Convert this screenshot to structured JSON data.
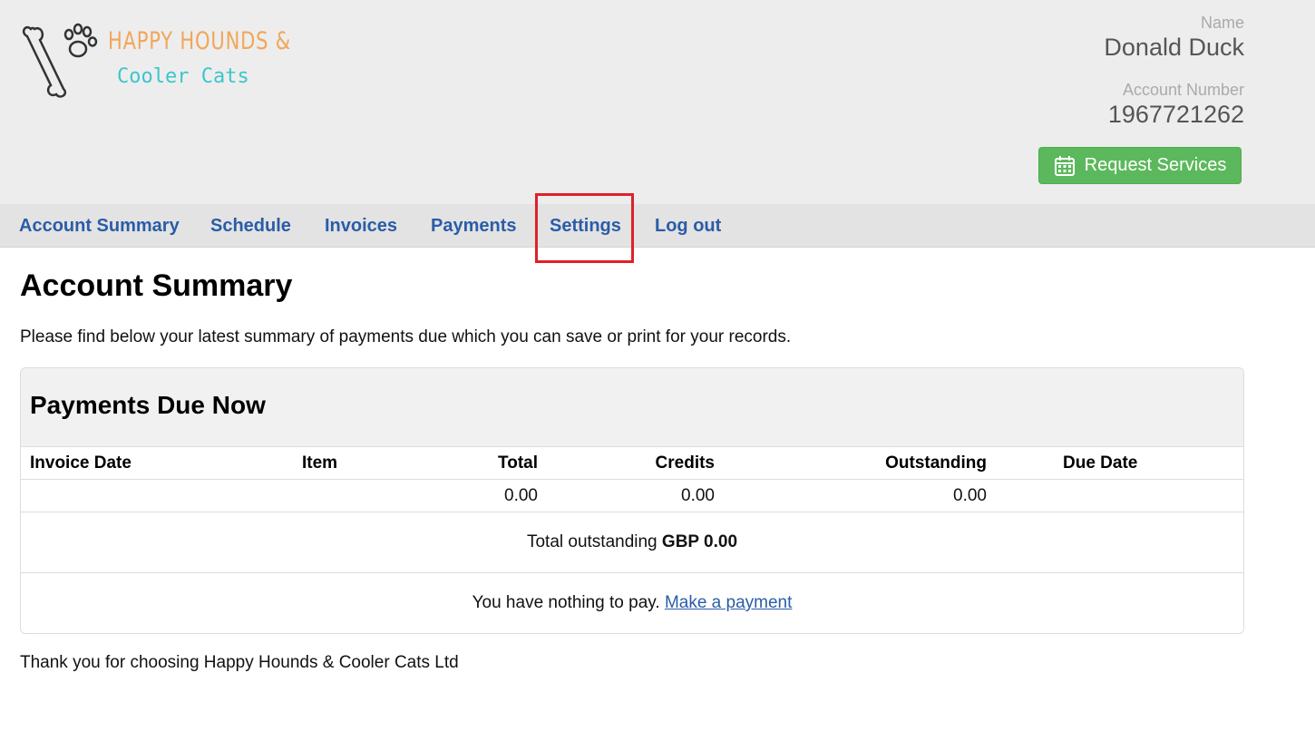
{
  "brand": {
    "line1": "HAPPY HOUNDS &",
    "line2": "Cooler Cats",
    "icon": "bone-and-paw-logo"
  },
  "account": {
    "name_label": "Name",
    "name_value": "Donald Duck",
    "number_label": "Account Number",
    "number_value": "1967721262"
  },
  "request_button": {
    "label": "Request Services",
    "icon": "calendar-icon"
  },
  "nav": {
    "items": [
      {
        "label": "Account Summary"
      },
      {
        "label": "Schedule"
      },
      {
        "label": "Invoices"
      },
      {
        "label": "Payments"
      },
      {
        "label": "Settings"
      },
      {
        "label": "Log out"
      }
    ]
  },
  "main": {
    "title": "Account Summary",
    "intro": "Please find below your latest summary of payments due which you can save or print for your records.",
    "panel": {
      "title": "Payments Due Now",
      "columns": [
        "Invoice Date",
        "Item",
        "Total",
        "Credits",
        "Outstanding",
        "Due Date"
      ],
      "row": {
        "invoice_date": "",
        "item": "",
        "total": "0.00",
        "credits": "0.00",
        "outstanding": "0.00",
        "due_date": ""
      },
      "total_label": "Total outstanding",
      "total_value": "GBP 0.00",
      "nothing_text": "You have nothing to pay.",
      "make_payment": "Make a payment"
    },
    "footer": "Thank you for choosing Happy Hounds & Cooler Cats Ltd"
  },
  "colors": {
    "header_bg": "#ededed",
    "nav_link": "#2a5ca8",
    "button_green": "#5cb85c",
    "highlight": "#e0202a",
    "logo_orange": "#f2a65a",
    "logo_teal": "#3cc6cc"
  }
}
